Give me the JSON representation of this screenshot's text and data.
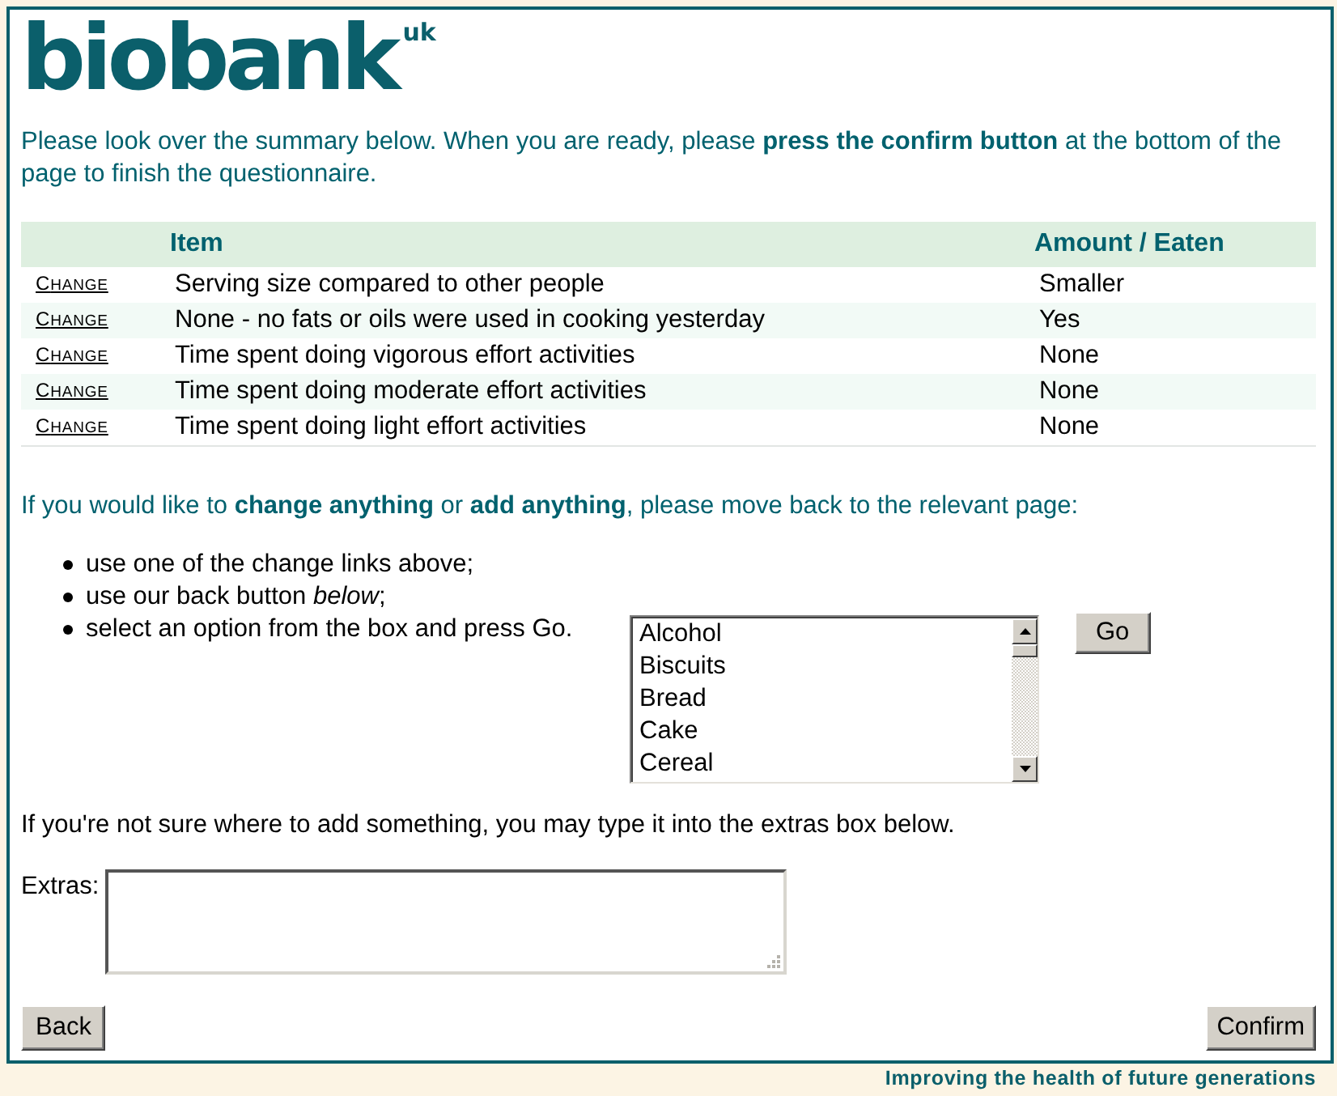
{
  "logo": {
    "text": "biobank$^{uk}$"
  },
  "intro": "Please look over the summary below. When you are ready, please **press the confirm button** at the bottom of the page to finish the questionnaire.",
  "table": {
    "columns": [
      "Item",
      "Amount / Eaten"
    ],
    "rows": [
      {
        "link": "CHANGE",
        "item": "Serving size compared to other people",
        "amount": "Smaller"
      },
      {
        "link": "CHANGE",
        "item": "None - no fats or oils were used in cooking yesterday",
        "amount": "Yes"
      },
      {
        "link": "CHANGE",
        "item": "Time spent doing vigorous effort activities",
        "amount": "None"
      },
      {
        "link": "CHANGE",
        "item": "Time spent doing moderate effort activities",
        "amount": "None"
      },
      {
        "link": "CHANGE",
        "item": "Time spent doing light effort activities",
        "amount": "None"
      }
    ]
  },
  "change_note": "If you would like to **change anything** or **add anything**, please move back to the relevant page:",
  "options": [
    "use one of the change links above;",
    "use our back button *below*;",
    "select an option from the box and press Go."
  ],
  "food_list": {
    "items": [
      {
        "label": "Alcohol",
        "selected": false
      },
      {
        "label": "Biscuits",
        "selected": false
      },
      {
        "label": "Bread",
        "selected": false
      },
      {
        "label": "Cake",
        "selected": false
      },
      {
        "label": "Cereal",
        "selected": false
      }
    ]
  },
  "go_button": "Go",
  "extras_note": "If you're not sure where to add something, you may type it into the extras box below.",
  "extras": {
    "label": "Extras:"
  },
  "buttons": {
    "back": "Back",
    "confirm": "Confirm"
  },
  "tagline": "Improving the health of future generations"
}
